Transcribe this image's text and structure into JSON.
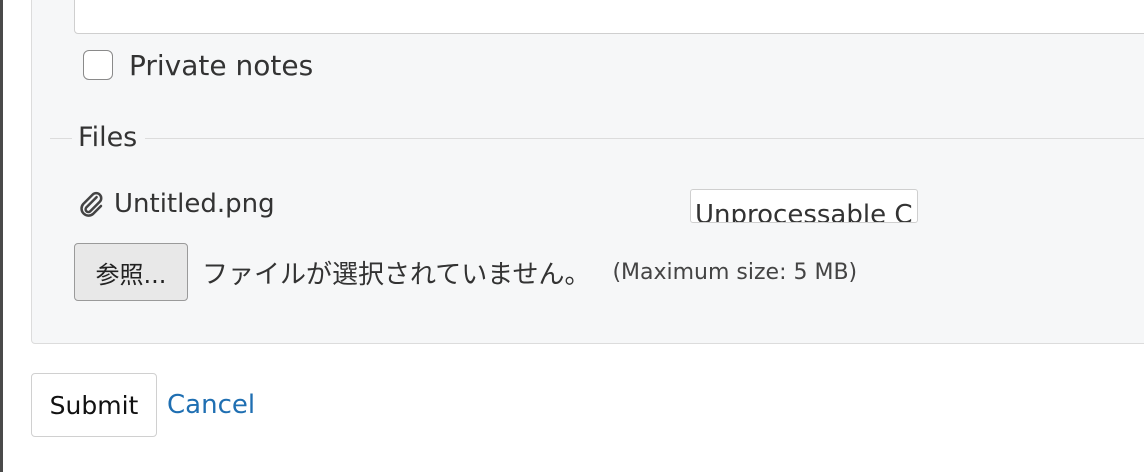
{
  "private_notes": {
    "label": "Private notes",
    "checked": false
  },
  "files": {
    "legend": "Files",
    "attachment": {
      "name": "Untitled.png",
      "description_value": "Unprocessable C"
    },
    "upload": {
      "browse_label": "参照...",
      "no_file_text": "ファイルが選択されていません。",
      "max_size_text": "(Maximum size: 5 MB)"
    }
  },
  "actions": {
    "submit_label": "Submit",
    "cancel_label": "Cancel"
  },
  "icons": {
    "attachment": "paperclip-icon"
  },
  "colors": {
    "link": "#1f6fb2",
    "panel_bg": "#f6f7f8",
    "border": "#dcdcdc"
  }
}
